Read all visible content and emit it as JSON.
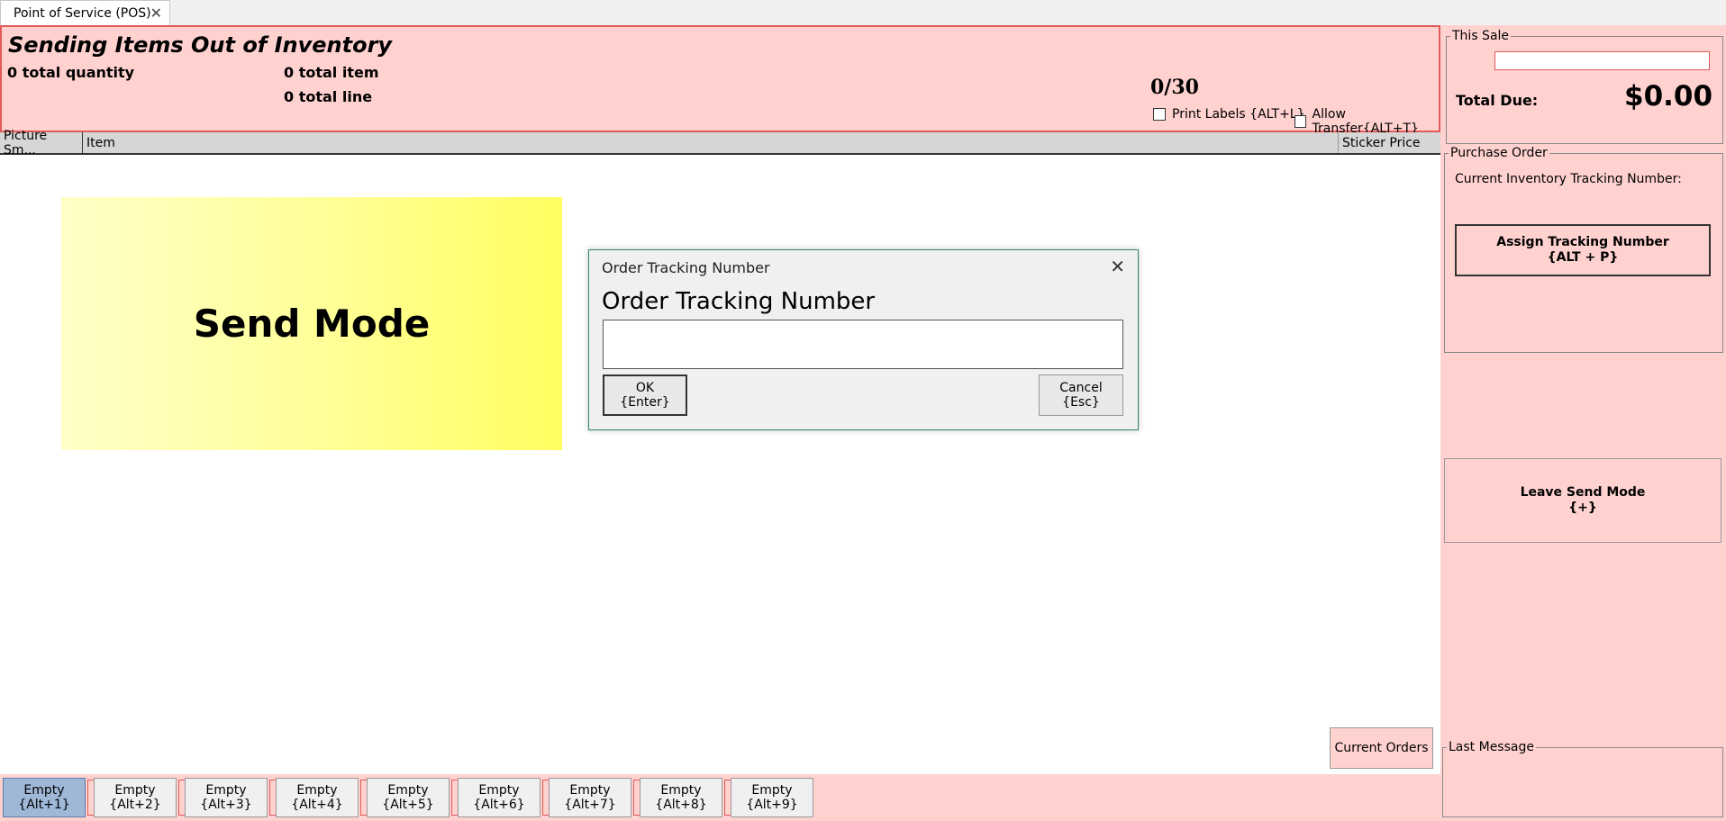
{
  "tab": {
    "label": "Point of Service (POS)"
  },
  "header": {
    "title": "Sending Items Out of Inventory",
    "total_quantity": "0 total quantity",
    "total_item": "0 total item",
    "total_line": "0 total line",
    "count": "0/30",
    "print_labels": "Print Labels {ALT+L}",
    "allow_transfer": "Allow Transfer{ALT+T}"
  },
  "grid": {
    "columns": [
      "Picture Sm...",
      "Item",
      "Sticker Price"
    ]
  },
  "send_mode": "Send Mode",
  "dialog": {
    "title": "Order Tracking Number",
    "heading": "Order Tracking Number",
    "input_value": "",
    "ok_line1": "OK",
    "ok_line2": "{Enter}",
    "cancel_line1": "Cancel",
    "cancel_line2": "{Esc}"
  },
  "current_orders": "Current Orders",
  "right": {
    "this_sale_legend": "This Sale",
    "sale_input": "",
    "total_due_label": "Total Due:",
    "total_due_value": "$0.00",
    "po_legend": "Purchase Order",
    "tracking_label": "Current Inventory Tracking Number:",
    "assign_line1": "Assign Tracking Number",
    "assign_line2": "{ALT + P}",
    "leave_line1": "Leave Send Mode",
    "leave_line2": "{+}",
    "last_message_legend": "Last Message"
  },
  "slots": [
    {
      "label": "Empty",
      "key": "{Alt+1}"
    },
    {
      "label": "Empty",
      "key": "{Alt+2}"
    },
    {
      "label": "Empty",
      "key": "{Alt+3}"
    },
    {
      "label": "Empty",
      "key": "{Alt+4}"
    },
    {
      "label": "Empty",
      "key": "{Alt+5}"
    },
    {
      "label": "Empty",
      "key": "{Alt+6}"
    },
    {
      "label": "Empty",
      "key": "{Alt+7}"
    },
    {
      "label": "Empty",
      "key": "{Alt+8}"
    },
    {
      "label": "Empty",
      "key": "{Alt+9}"
    }
  ],
  "colors": {
    "header_bg": "#ffd2d0",
    "header_border": "#e05a5a",
    "dialog_border": "#2e8b6e",
    "active_slot": "#9fb8d8"
  }
}
